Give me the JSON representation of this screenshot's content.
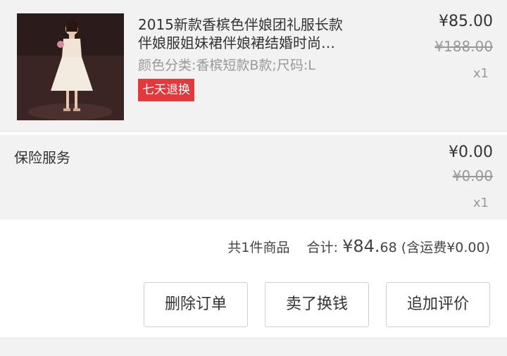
{
  "product": {
    "title_line1": "2015新款香槟色伴娘团礼服长款",
    "title_line2": "伴娘服姐妹裙伴娘裙结婚时尚…",
    "sku": "颜色分类:香槟短款B款;尺码:L",
    "badge": "七天退换",
    "price": "¥85.00",
    "original_price": "¥188.00",
    "quantity": "x1"
  },
  "service": {
    "label": "保险服务",
    "price": "¥0.00",
    "original_price": "¥0.00",
    "quantity": "x1"
  },
  "summary": {
    "count_text": "共1件商品",
    "total_label": "合计:",
    "total_main": "¥84.",
    "total_cents": "68",
    "shipping": "(含运费¥0.00)"
  },
  "actions": {
    "delete": "删除订单",
    "sell": "卖了换钱",
    "review": "追加评价"
  }
}
